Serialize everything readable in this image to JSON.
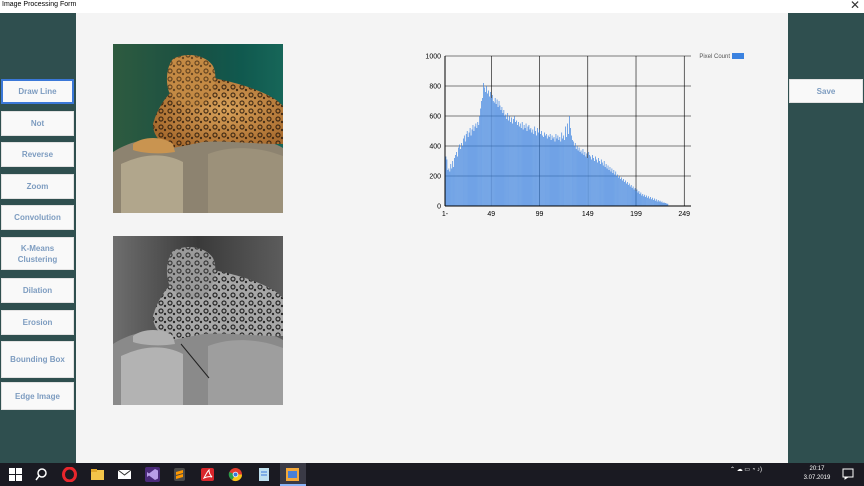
{
  "window": {
    "title": "Image Processing Form",
    "close_glyph": "✕"
  },
  "left_buttons": [
    {
      "label": "Draw Line"
    },
    {
      "label": "Not"
    },
    {
      "label": "Reverse"
    },
    {
      "label": "Zoom"
    },
    {
      "label": "Convolution"
    },
    {
      "label": "K-Means Clustering"
    },
    {
      "label": "Dilation"
    },
    {
      "label": "Erosion"
    },
    {
      "label": "Bounding Box"
    },
    {
      "label": "Edge Image"
    }
  ],
  "right_buttons": [
    {
      "label": "Save"
    }
  ],
  "images": {
    "original": {
      "icon": "color-leopard-image"
    },
    "processed": {
      "icon": "grayscale-leopard-image"
    }
  },
  "colors": {
    "panel": "#2f4f4f",
    "content_bg": "#f4f4f4",
    "button_text": "#7d9cc0",
    "bar": "#3b82e0"
  },
  "chart_data": {
    "type": "bar",
    "title": "",
    "xlabel": "",
    "ylabel": "",
    "ylim": [
      0,
      1000
    ],
    "xlim": [
      1,
      256
    ],
    "x_ticks": [
      "1-",
      "49",
      "99",
      "149",
      "199",
      "249"
    ],
    "x_tick_values": [
      1,
      49,
      99,
      149,
      199,
      249
    ],
    "y_ticks": [
      "0",
      "200",
      "400",
      "600",
      "800",
      "1000"
    ],
    "y_tick_values": [
      0,
      200,
      400,
      600,
      800,
      1000
    ],
    "grid": true,
    "legend_position": "top-right",
    "series": [
      {
        "name": "Pixel Count",
        "x_start": 1,
        "values": [
          40,
          330,
          310,
          240,
          250,
          230,
          280,
          250,
          300,
          260,
          320,
          340,
          360,
          330,
          390,
          410,
          380,
          420,
          400,
          450,
          470,
          430,
          480,
          500,
          460,
          490,
          520,
          470,
          510,
          540,
          500,
          530,
          550,
          520,
          560,
          540,
          600,
          650,
          700,
          720,
          820,
          790,
          760,
          800,
          750,
          770,
          730,
          760,
          720,
          740,
          700,
          690,
          720,
          680,
          710,
          660,
          700,
          670,
          640,
          660,
          620,
          640,
          600,
          610,
          580,
          620,
          570,
          600,
          560,
          590,
          550,
          580,
          600,
          560,
          570,
          540,
          560,
          530,
          550,
          520,
          560,
          510,
          540,
          520,
          550,
          500,
          530,
          540,
          510,
          520,
          490,
          510,
          480,
          530,
          500,
          470,
          520,
          490,
          510,
          480,
          500,
          470,
          460,
          490,
          470,
          480,
          450,
          470,
          460,
          480,
          440,
          470,
          450,
          460,
          430,
          480,
          450,
          470,
          440,
          460,
          430,
          490,
          450,
          470,
          440,
          530,
          460,
          550,
          480,
          600,
          520,
          470,
          440,
          430,
          400,
          420,
          380,
          400,
          370,
          390,
          360,
          370,
          350,
          380,
          340,
          360,
          330,
          350,
          320,
          360,
          340,
          330,
          310,
          340,
          320,
          300,
          330,
          310,
          290,
          320,
          300,
          280,
          310,
          290,
          270,
          300,
          260,
          280,
          250,
          270,
          240,
          260,
          230,
          250,
          220,
          240,
          210,
          230,
          200,
          210,
          190,
          200,
          180,
          190,
          170,
          180,
          160,
          170,
          150,
          160,
          140,
          150,
          130,
          140,
          120,
          130,
          110,
          120,
          100,
          110,
          90,
          100,
          80,
          90,
          70,
          80,
          65,
          75,
          60,
          70,
          55,
          65,
          50,
          60,
          45,
          55,
          40,
          50,
          35,
          45,
          30,
          40,
          30,
          35,
          25,
          30,
          20,
          25,
          20,
          20,
          15,
          15
        ]
      }
    ]
  },
  "taskbar": {
    "icons": [
      "windows-start-icon",
      "search-icon",
      "opera-icon",
      "file-explorer-icon",
      "mail-icon",
      "visual-studio-icon",
      "sublime-icon",
      "pdf-reader-icon",
      "chrome-icon",
      "notepad-icon",
      "image-app-icon"
    ],
    "clock_time": "20:17",
    "clock_date": "3.07.2019",
    "tray_glyphs": "⌃ ☁ ▭ ◔ ♪)"
  }
}
